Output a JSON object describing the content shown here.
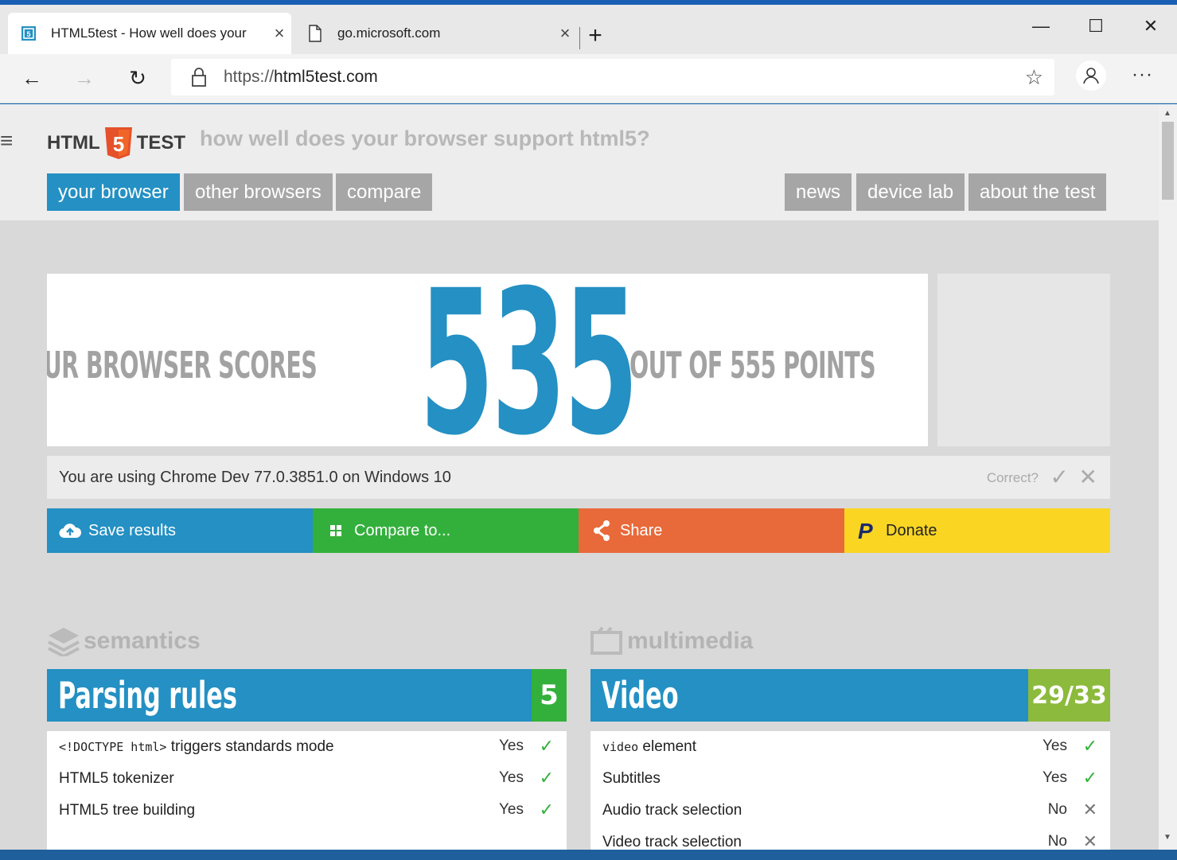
{
  "browser": {
    "tabs": [
      {
        "title": "HTML5test - How well does your",
        "close": "×"
      },
      {
        "title": "go.microsoft.com",
        "close": "×"
      }
    ],
    "new_tab": "+",
    "window": {
      "minimize": "—",
      "maximize": "☐",
      "close": "✕"
    },
    "url_scheme": "https://",
    "url_host": "html5test.com",
    "nav": {
      "back": "←",
      "forward": "→",
      "refresh": "↻",
      "star": "☆",
      "more": "···"
    }
  },
  "site": {
    "logo_left": "HTML",
    "logo_mark": "5",
    "logo_right": "TEST",
    "tagline": "how well does your browser support html5?",
    "nav_left": [
      "your browser",
      "other browsers",
      "compare"
    ],
    "nav_right": [
      "news",
      "device lab",
      "about the test"
    ]
  },
  "score": {
    "prefix": "YOUR BROWSER SCORES",
    "value": "535",
    "suffix": "OUT OF 555 POINTS",
    "max": 555
  },
  "using": {
    "text": "You are using Chrome Dev 77.0.3851.0 on Windows 10",
    "correct_label": "Correct?",
    "yes_glyph": "✓",
    "no_glyph": "✕"
  },
  "actions": [
    {
      "label": "Save results",
      "color": "#2490c3",
      "icon": "cloud-upload-icon"
    },
    {
      "label": "Compare to...",
      "color": "#33b03c",
      "icon": "grid-icon"
    },
    {
      "label": "Share",
      "color": "#e8693a",
      "icon": "share-icon"
    },
    {
      "label": "Donate",
      "color": "#fad623",
      "icon": "paypal-icon"
    }
  ],
  "categories": [
    {
      "name": "semantics",
      "section": "Parsing rules",
      "score": "5",
      "score_color": "#33b03c",
      "rows": [
        {
          "code": "<!DOCTYPE html>",
          "label": " triggers standards mode",
          "result": "Yes",
          "mark": "✓"
        },
        {
          "code": "",
          "label": "HTML5 tokenizer",
          "result": "Yes",
          "mark": "✓"
        },
        {
          "code": "",
          "label": "HTML5 tree building",
          "result": "Yes",
          "mark": "✓"
        }
      ]
    },
    {
      "name": "multimedia",
      "section": "Video",
      "score": "29/33",
      "score_color": "#8cba3c",
      "rows": [
        {
          "code": "video",
          "label": " element",
          "result": "Yes",
          "mark": "✓"
        },
        {
          "code": "",
          "label": "Subtitles",
          "result": "Yes",
          "mark": "✓"
        },
        {
          "code": "",
          "label": "Audio track selection",
          "result": "No",
          "mark": "✕"
        },
        {
          "code": "",
          "label": "Video track selection",
          "result": "No",
          "mark": "✕"
        }
      ]
    }
  ]
}
